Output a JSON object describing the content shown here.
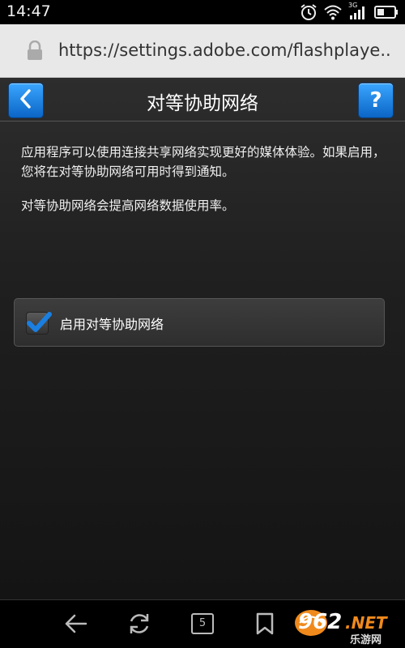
{
  "status_bar": {
    "time": "14:47",
    "network_type": "3G",
    "icons": [
      "alarm-icon",
      "wifi-icon",
      "signal-icon",
      "battery-icon"
    ]
  },
  "browser": {
    "url": "https://settings.adobe.com/flashplaye.."
  },
  "settings": {
    "title": "对等协助网络",
    "help_label": "?",
    "description": "应用程序可以使用连接共享网络实现更好的媒体体验。如果启用，您将在对等协助网络可用时得到通知。",
    "note": "对等协助网络会提高网络数据使用率。",
    "option": {
      "label": "启用对等协助网络",
      "checked": true
    }
  },
  "bottom_nav": {
    "tab_count": "5",
    "icons": [
      "back-icon",
      "refresh-icon",
      "tabs-icon",
      "bookmark-icon"
    ]
  },
  "watermark": {
    "brand_number": "962",
    "brand_suffix": ".NET",
    "brand_cn": "乐游网"
  },
  "colors": {
    "accent_blue": "#1a7fe0",
    "panel_dark": "#1f1f1f",
    "url_bar": "#e8e8e8",
    "watermark_orange": "#f08a1c"
  }
}
